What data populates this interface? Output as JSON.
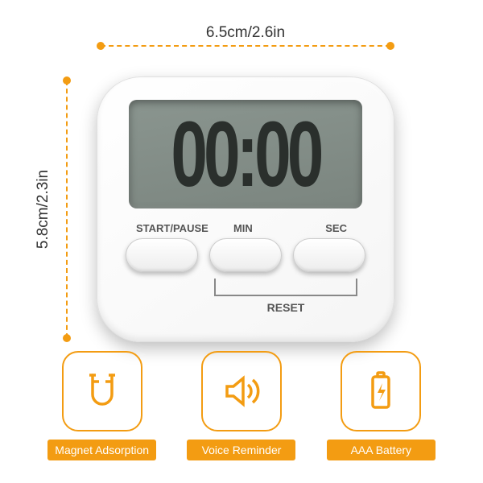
{
  "dimensions": {
    "width_label": "6.5cm/2.6in",
    "height_label": "5.8cm/2.3in"
  },
  "timer": {
    "display": "00:00",
    "buttons": {
      "start_pause": "START/PAUSE",
      "min": "MIN",
      "sec": "SEC",
      "reset": "RESET"
    }
  },
  "features": [
    {
      "label": "Magnet Adsorption",
      "icon": "magnet"
    },
    {
      "label": "Voice Reminder",
      "icon": "speaker"
    },
    {
      "label": "AAA Battery",
      "icon": "battery"
    }
  ],
  "colors": {
    "accent": "#f39c12"
  }
}
